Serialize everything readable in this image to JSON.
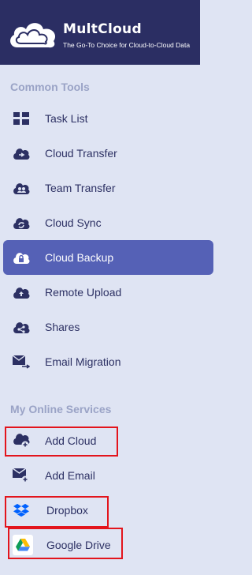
{
  "brand": {
    "name": "MultCloud",
    "tagline": "The Go-To Choice for Cloud-to-Cloud Data"
  },
  "sections": {
    "common_tools": "Common Tools",
    "online_services": "My Online Services"
  },
  "common_tools": [
    {
      "label": "Task List",
      "icon": "grid-icon",
      "active": false
    },
    {
      "label": "Cloud Transfer",
      "icon": "cloud-transfer-icon",
      "active": false
    },
    {
      "label": "Team Transfer",
      "icon": "team-transfer-icon",
      "active": false
    },
    {
      "label": "Cloud Sync",
      "icon": "cloud-sync-icon",
      "active": false
    },
    {
      "label": "Cloud Backup",
      "icon": "cloud-backup-icon",
      "active": true
    },
    {
      "label": "Remote Upload",
      "icon": "remote-upload-icon",
      "active": false
    },
    {
      "label": "Shares",
      "icon": "share-icon",
      "active": false
    },
    {
      "label": "Email Migration",
      "icon": "email-migration-icon",
      "active": false
    }
  ],
  "online_services": [
    {
      "label": "Add Cloud",
      "icon": "add-cloud-icon"
    },
    {
      "label": "Add Email",
      "icon": "add-email-icon"
    },
    {
      "label": "Dropbox",
      "icon": "dropbox-icon"
    },
    {
      "label": "Google Drive",
      "icon": "google-drive-icon"
    }
  ],
  "colors": {
    "header_bg": "#2b2e63",
    "sidebar_bg": "#dfe4f3",
    "active_bg": "#5561b6",
    "text": "#2c3063",
    "highlight": "#e3141c"
  }
}
